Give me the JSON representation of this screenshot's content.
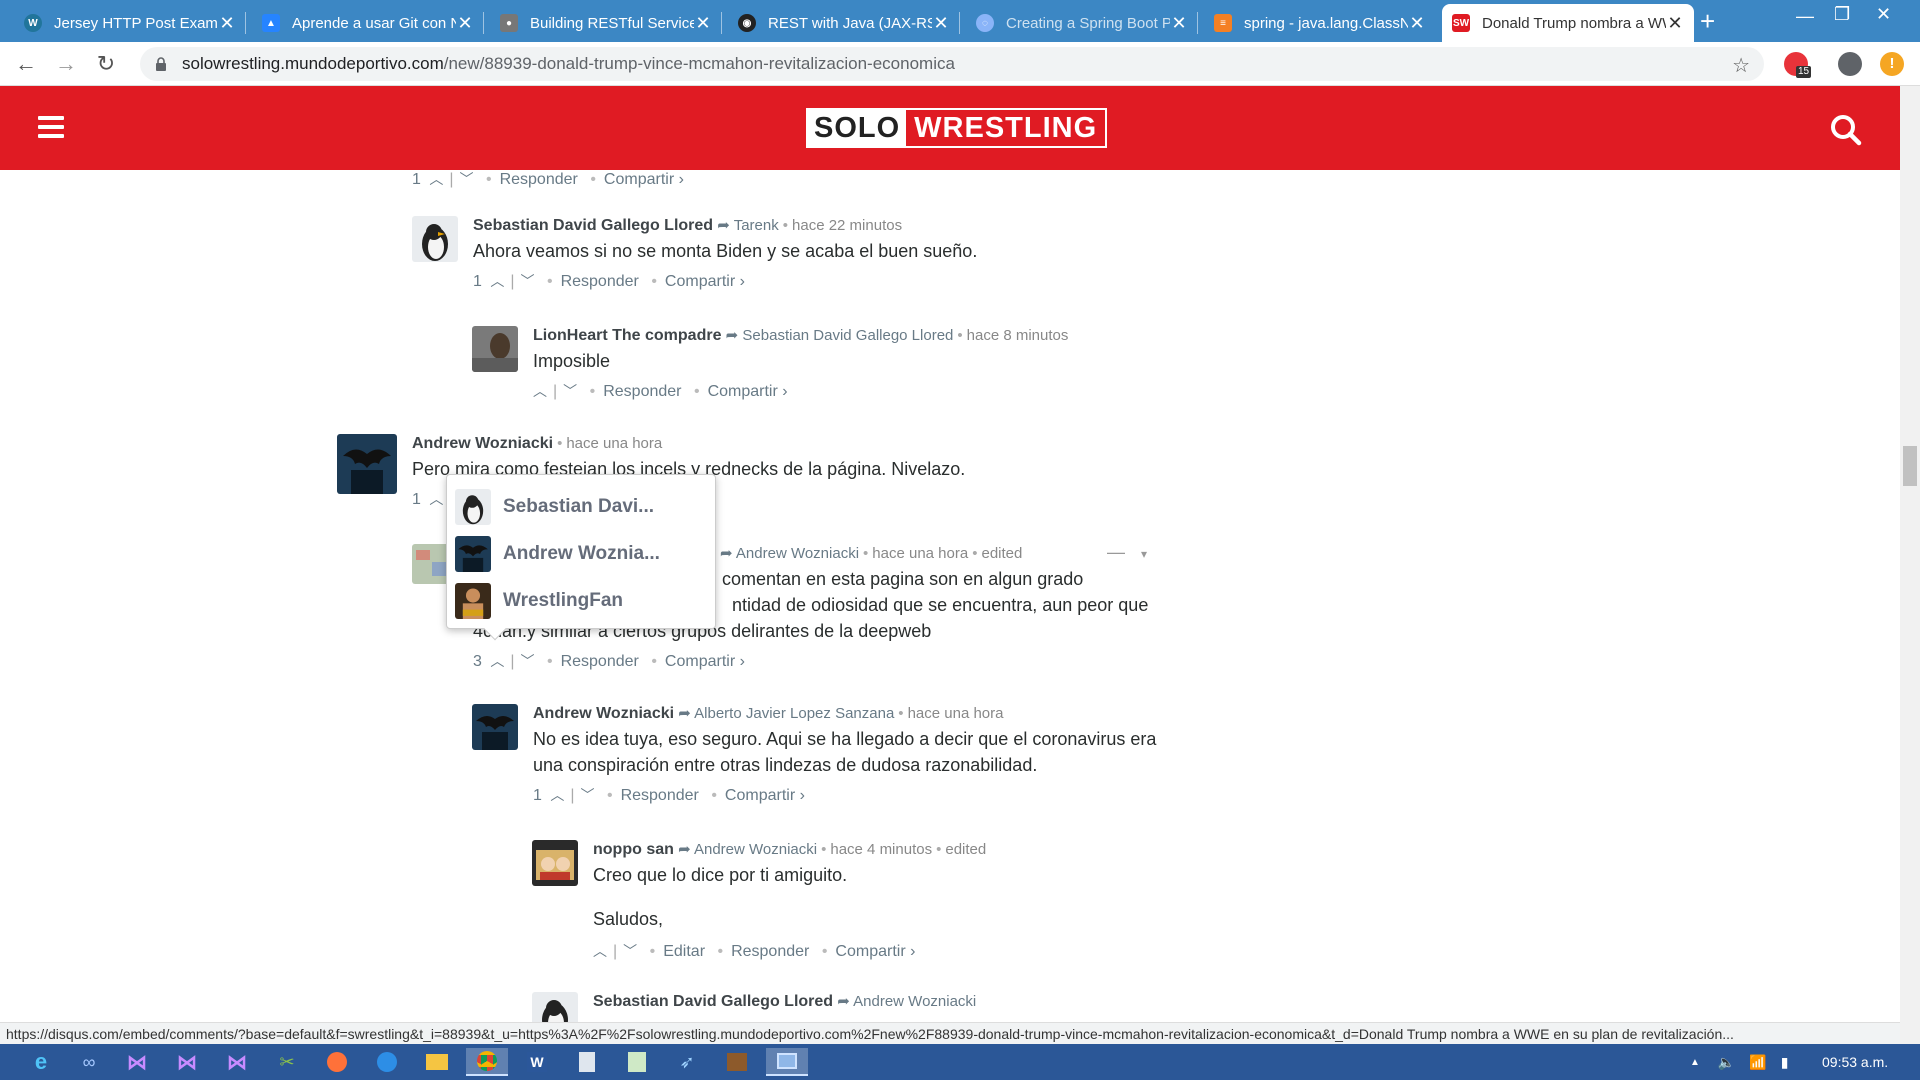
{
  "browser": {
    "tabs": [
      {
        "title": "Jersey HTTP Post Example",
        "favicon": "wordpress-icon",
        "color": "#21759b"
      },
      {
        "title": "Aprende a usar Git con NetBeans",
        "favicon": "atlassian-icon",
        "color": "#2684ff"
      },
      {
        "title": "Building RESTful Services",
        "favicon": "person-icon",
        "color": "#777777"
      },
      {
        "title": "REST with Java (JAX-RS)",
        "favicon": "github-icon",
        "color": "#222222"
      },
      {
        "title": "Creating a Spring Boot Project",
        "favicon": "globe-icon",
        "color": "#8ab4f8"
      },
      {
        "title": "spring - java.lang.ClassNotFound",
        "favicon": "stackoverflow-icon",
        "color": "#f48024"
      },
      {
        "title": "Donald Trump nombra a WWE",
        "favicon": "sw-icon",
        "color": "#e01b23",
        "favicon_text": "SW",
        "active": true
      }
    ],
    "address": {
      "host": "solowrestling.mundodeportivo.com",
      "path": "/new/88939-donald-trump-vince-mcmahon-revitalizacion-economica"
    },
    "extension_badge": "15"
  },
  "site": {
    "logo_part1": "SOLO",
    "logo_part2": "WRESTLING",
    "brand_color": "#e01b23"
  },
  "comments": [
    {
      "author": "",
      "target": "",
      "time": "",
      "text": "",
      "votes": "1",
      "actions": [
        "Responder",
        "Compartir ›"
      ]
    },
    {
      "author": "Sebastian David Gallego Llored",
      "target": "Tarenk",
      "time": "hace 22 minutos",
      "text": "Ahora veamos si no se monta Biden y se acaba el buen sueño.",
      "votes": "1",
      "actions": [
        "Responder",
        "Compartir ›"
      ]
    },
    {
      "author": "LionHeart The compadre",
      "target": "Sebastian David Gallego Llored",
      "time": "hace 8 minutos",
      "text": "Imposible",
      "votes": "",
      "actions": [
        "Responder",
        "Compartir ›"
      ]
    },
    {
      "author": "Andrew Wozniacki",
      "target": "",
      "time": "hace una hora",
      "text": "Pero mira como festejan los incels y rednecks de la página. Nivelazo.",
      "votes": "1",
      "actions": []
    },
    {
      "author": "",
      "target": "Andrew Wozniacki",
      "time": "hace una hora",
      "edited": "edited",
      "text": "comentan en esta pagina son en algun grado",
      "text2": "ntidad de odiosidad que se encuentra, aun peor que",
      "text3": "4chan.y similar a ciertos grupos delirantes de la deepweb",
      "votes": "3",
      "actions": [
        "Responder",
        "Compartir ›"
      ]
    },
    {
      "author": "Andrew Wozniacki",
      "target": "Alberto Javier Lopez Sanzana",
      "time": "hace una hora",
      "text": "No es idea tuya, eso seguro. Aqui se ha llegado a decir que el coronavirus era una conspiración entre otras lindezas de dudosa razonabilidad.",
      "votes": "1",
      "actions": [
        "Responder",
        "Compartir ›"
      ]
    },
    {
      "author": "noppo san",
      "target": "Andrew Wozniacki",
      "time": "hace 4 minutos",
      "edited": "edited",
      "text": "Creo que lo dice por ti amiguito.",
      "text2": "Saludos,",
      "votes": "",
      "actions": [
        "Editar",
        "Responder",
        "Compartir ›"
      ]
    },
    {
      "author": "Sebastian David Gallego Llored",
      "target": "Andrew Wozniacki",
      "time": "",
      "text": "",
      "votes": "",
      "actions": []
    }
  ],
  "upvoters": [
    {
      "name": "Sebastian Davi...",
      "avatar": "penguin-avatar"
    },
    {
      "name": "Andrew Woznia...",
      "avatar": "batman-avatar"
    },
    {
      "name": "WrestlingFan",
      "avatar": "wrestler-avatar"
    }
  ],
  "status_url": "https://disqus.com/embed/comments/?base=default&f=swrestling&t_i=88939&t_u=https%3A%2F%2Fsolowrestling.mundodeportivo.com%2Fnew%2F88939-donald-trump-vince-mcmahon-revitalizacion-economica&t_d=Donald Trump nombra a WWE en su plan de revitalización...",
  "taskbar": {
    "clock": "09:53 a.m."
  }
}
